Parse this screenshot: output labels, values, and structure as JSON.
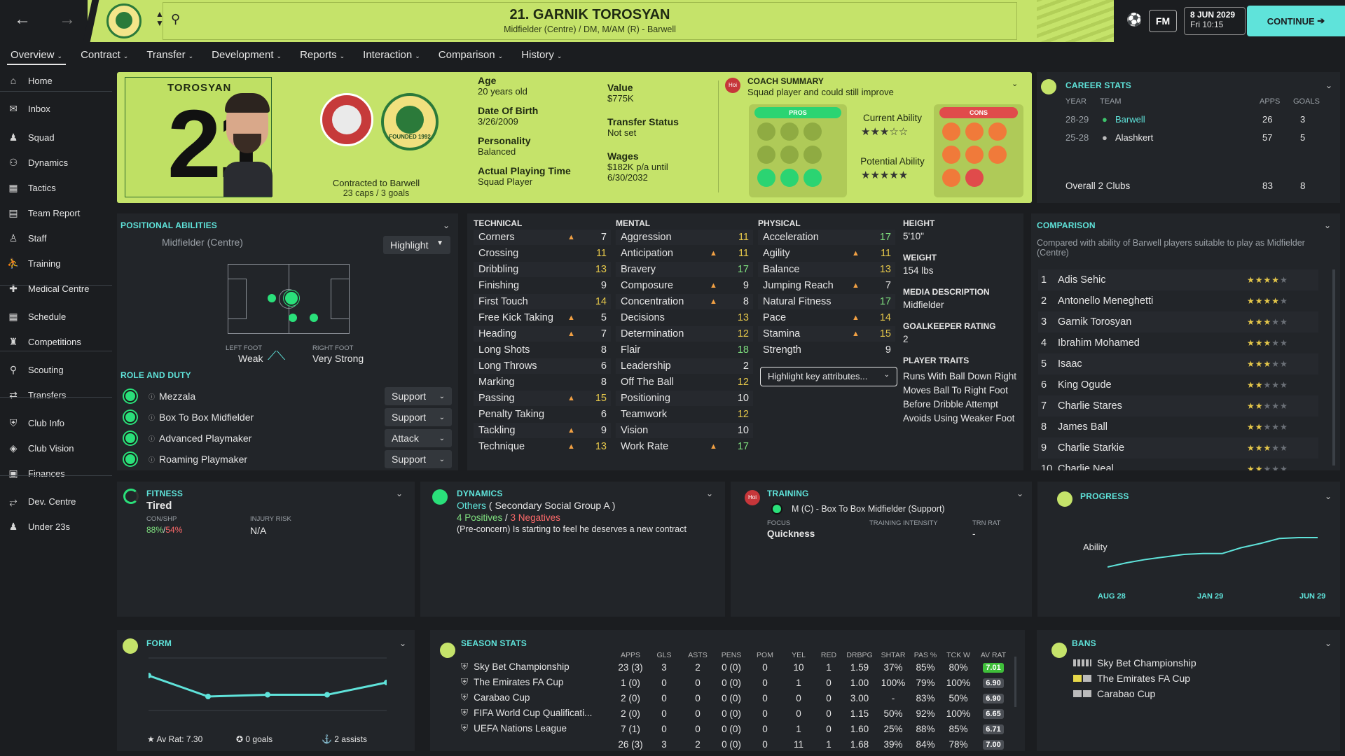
{
  "header": {
    "name": "21. GARNIK TOROSYAN",
    "subtitle": "Midfielder (Centre) / DM, M/AM (R) - Barwell",
    "date": "8 JUN 2029",
    "time": "Fri 10:15",
    "continue": "CONTINUE",
    "fm": "FM"
  },
  "nav": [
    "Overview",
    "Contract",
    "Transfer",
    "Development",
    "Reports",
    "Interaction",
    "Comparison",
    "History"
  ],
  "sidebar": [
    {
      "label": "Home",
      "icon": "home-icon"
    },
    {
      "label": "Inbox",
      "icon": "inbox-icon"
    },
    {
      "label": "Squad",
      "icon": "squad-icon"
    },
    {
      "label": "Dynamics",
      "icon": "dynamics-icon"
    },
    {
      "label": "Tactics",
      "icon": "tactics-icon"
    },
    {
      "label": "Team Report",
      "icon": "report-icon"
    },
    {
      "label": "Staff",
      "icon": "staff-icon"
    },
    {
      "label": "Training",
      "icon": "training-icon"
    },
    {
      "label": "Medical Centre",
      "icon": "medical-icon"
    },
    {
      "label": "Schedule",
      "icon": "calendar-icon"
    },
    {
      "label": "Competitions",
      "icon": "trophy-icon"
    },
    {
      "label": "Scouting",
      "icon": "search-icon"
    },
    {
      "label": "Transfers",
      "icon": "transfers-icon"
    },
    {
      "label": "Club Info",
      "icon": "shield-icon"
    },
    {
      "label": "Club Vision",
      "icon": "vision-icon"
    },
    {
      "label": "Finances",
      "icon": "finances-icon"
    },
    {
      "label": "Dev. Centre",
      "icon": "dev-icon"
    },
    {
      "label": "Under 23s",
      "icon": "under23-icon"
    }
  ],
  "profile": {
    "surname": "TOROSYAN",
    "number": "21",
    "contracted": "Contracted to Barwell",
    "caps": "23 caps / 3 goals",
    "age_l": "Age",
    "age": "20 years old",
    "dob_l": "Date Of Birth",
    "dob": "3/26/2009",
    "pers_l": "Personality",
    "pers": "Balanced",
    "apt_l": "Actual Playing Time",
    "apt": "Squad Player",
    "val_l": "Value",
    "val": "$775K",
    "ts_l": "Transfer Status",
    "ts": "Not set",
    "wage_l": "Wages",
    "wage": "$182K p/a until",
    "wage2": "6/30/2032",
    "founded": "FOUNDED 1992"
  },
  "coach": {
    "title": "COACH SUMMARY",
    "text": "Squad player and could still improve",
    "pros": "PROS",
    "cons": "CONS",
    "ca": "Current Ability",
    "pa": "Potential Ability",
    "hoi": "Hoi"
  },
  "career": {
    "title": "CAREER STATS",
    "h": [
      "YEAR",
      "TEAM",
      "APPS",
      "GOALS"
    ],
    "rows": [
      [
        "28-29",
        "Barwell",
        "26",
        "3"
      ],
      [
        "25-28",
        "Alashkert",
        "57",
        "5"
      ]
    ],
    "total": [
      "Overall 2 Clubs",
      "83",
      "8"
    ]
  },
  "positional": {
    "title": "POSITIONAL ABILITIES",
    "pos": "Midfielder (Centre)",
    "highlight": "Highlight",
    "lf_l": "LEFT FOOT",
    "lf": "Weak",
    "rf_l": "RIGHT FOOT",
    "rf": "Very Strong",
    "rd_title": "ROLE AND DUTY",
    "roles": [
      [
        "Mezzala",
        "Support"
      ],
      [
        "Box To Box Midfielder",
        "Support"
      ],
      [
        "Advanced Playmaker",
        "Attack"
      ],
      [
        "Roaming Playmaker",
        "Support"
      ]
    ]
  },
  "technical": {
    "title": "TECHNICAL",
    "rows": [
      [
        "Corners",
        "7"
      ],
      [
        "Crossing",
        "11"
      ],
      [
        "Dribbling",
        "13"
      ],
      [
        "Finishing",
        "9"
      ],
      [
        "First Touch",
        "14"
      ],
      [
        "Free Kick Taking",
        "5"
      ],
      [
        "Heading",
        "7"
      ],
      [
        "Long Shots",
        "8"
      ],
      [
        "Long Throws",
        "6"
      ],
      [
        "Marking",
        "8"
      ],
      [
        "Passing",
        "15"
      ],
      [
        "Penalty Taking",
        "6"
      ],
      [
        "Tackling",
        "9"
      ],
      [
        "Technique",
        "13"
      ]
    ]
  },
  "mental": {
    "title": "MENTAL",
    "rows": [
      [
        "Aggression",
        "11"
      ],
      [
        "Anticipation",
        "11"
      ],
      [
        "Bravery",
        "17"
      ],
      [
        "Composure",
        "9"
      ],
      [
        "Concentration",
        "8"
      ],
      [
        "Decisions",
        "13"
      ],
      [
        "Determination",
        "12"
      ],
      [
        "Flair",
        "18"
      ],
      [
        "Leadership",
        "2"
      ],
      [
        "Off The Ball",
        "12"
      ],
      [
        "Positioning",
        "10"
      ],
      [
        "Teamwork",
        "12"
      ],
      [
        "Vision",
        "10"
      ],
      [
        "Work Rate",
        "17"
      ]
    ]
  },
  "physical": {
    "title": "PHYSICAL",
    "rows": [
      [
        "Acceleration",
        "17"
      ],
      [
        "Agility",
        "11"
      ],
      [
        "Balance",
        "13"
      ],
      [
        "Jumping Reach",
        "7"
      ],
      [
        "Natural Fitness",
        "17"
      ],
      [
        "Pace",
        "14"
      ],
      [
        "Stamina",
        "15"
      ],
      [
        "Strength",
        "9"
      ]
    ],
    "hka": "Highlight key attributes..."
  },
  "info": {
    "h_l": "HEIGHT",
    "h": "5'10\"",
    "w_l": "WEIGHT",
    "w": "154 lbs",
    "md_l": "MEDIA DESCRIPTION",
    "md": "Midfielder",
    "gk_l": "GOALKEEPER RATING",
    "gk": "2",
    "pt_l": "PLAYER TRAITS",
    "traits": [
      "Runs With Ball Down Right",
      "Moves Ball To Right Foot",
      "Before Dribble Attempt",
      "Avoids Using Weaker Foot"
    ]
  },
  "comparison": {
    "title": "COMPARISON",
    "desc": "Compared with ability of Barwell players suitable to play as Midfielder (Centre)",
    "rows": [
      [
        "1",
        "Adis Sehic"
      ],
      [
        "2",
        "Antonello Meneghetti"
      ],
      [
        "3",
        "Garnik Torosyan"
      ],
      [
        "4",
        "Ibrahim Mohamed"
      ],
      [
        "5",
        "Isaac"
      ],
      [
        "6",
        "King Ogude"
      ],
      [
        "7",
        "Charlie Stares"
      ],
      [
        "8",
        "James Ball"
      ],
      [
        "9",
        "Charlie Starkie"
      ],
      [
        "10",
        "Charlie Neal"
      ]
    ],
    "stars": [
      3.5,
      3.5,
      3,
      3,
      2.5,
      2,
      1.5,
      1.5,
      3,
      2
    ]
  },
  "fitness": {
    "title": "FITNESS",
    "state": "Tired",
    "con_l": "CON/SHP",
    "con": "88%",
    "shp": "54%",
    "inj_l": "INJURY RISK",
    "inj": "N/A"
  },
  "dynamics": {
    "title": "DYNAMICS",
    "group": "Others",
    "group2": "( Secondary Social Group A )",
    "pos": "4 Positives",
    "neg": "3 Negatives",
    "concern": "(Pre-concern) Is starting to feel he deserves a new contract"
  },
  "training": {
    "title": "TRAINING",
    "role": "M (C) - Box To Box Midfielder (Support)",
    "focus_l": "FOCUS",
    "focus": "Quickness",
    "ti_l": "TRAINING INTENSITY",
    "trn_l": "TRN RAT",
    "trn": "-"
  },
  "progress": {
    "title": "PROGRESS",
    "ability": "Ability",
    "x": [
      "AUG 28",
      "JAN 29",
      "JUN 29"
    ]
  },
  "form": {
    "title": "FORM",
    "avr": "Av Rat: 7.30",
    "goals": "0 goals",
    "assists": "2 assists"
  },
  "season": {
    "title": "SEASON STATS",
    "h": [
      "APPS",
      "GLS",
      "ASTS",
      "PENS",
      "POM",
      "YEL",
      "RED",
      "DRBPG",
      "SHTAR",
      "PAS %",
      "TCK W",
      "AV RAT"
    ],
    "rows": [
      [
        "Sky Bet Championship",
        "23 (3)",
        "3",
        "2",
        "0 (0)",
        "0",
        "10",
        "1",
        "1.59",
        "37%",
        "85%",
        "80%",
        "7.01"
      ],
      [
        "The Emirates FA Cup",
        "1 (0)",
        "0",
        "0",
        "0 (0)",
        "0",
        "1",
        "0",
        "1.00",
        "100%",
        "79%",
        "100%",
        "6.90"
      ],
      [
        "Carabao Cup",
        "2 (0)",
        "0",
        "0",
        "0 (0)",
        "0",
        "0",
        "0",
        "3.00",
        "-",
        "83%",
        "50%",
        "6.90"
      ],
      [
        "FIFA World Cup Qualificati...",
        "2 (0)",
        "0",
        "0",
        "0 (0)",
        "0",
        "0",
        "0",
        "1.15",
        "50%",
        "92%",
        "100%",
        "6.65"
      ],
      [
        "UEFA Nations League",
        "7 (1)",
        "0",
        "0",
        "0 (0)",
        "0",
        "1",
        "0",
        "1.60",
        "25%",
        "88%",
        "85%",
        "6.71"
      ],
      [
        "",
        "26 (3)",
        "3",
        "2",
        "0 (0)",
        "0",
        "11",
        "1",
        "1.68",
        "39%",
        "84%",
        "78%",
        "7.00"
      ]
    ]
  },
  "bans": {
    "title": "BANS",
    "rows": [
      "Sky Bet Championship",
      "The Emirates FA Cup",
      "Carabao Cup"
    ]
  },
  "chart_data": [
    {
      "type": "line",
      "title": "FORM",
      "values": [
        7.5,
        6.9,
        6.95,
        6.95,
        7.3
      ]
    },
    {
      "type": "line",
      "title": "PROGRESS",
      "categories": [
        "AUG 28",
        "JAN 29",
        "JUN 29"
      ],
      "values": [
        40,
        45,
        49,
        52,
        55,
        56,
        56,
        63,
        68,
        74,
        75,
        75
      ]
    }
  ]
}
